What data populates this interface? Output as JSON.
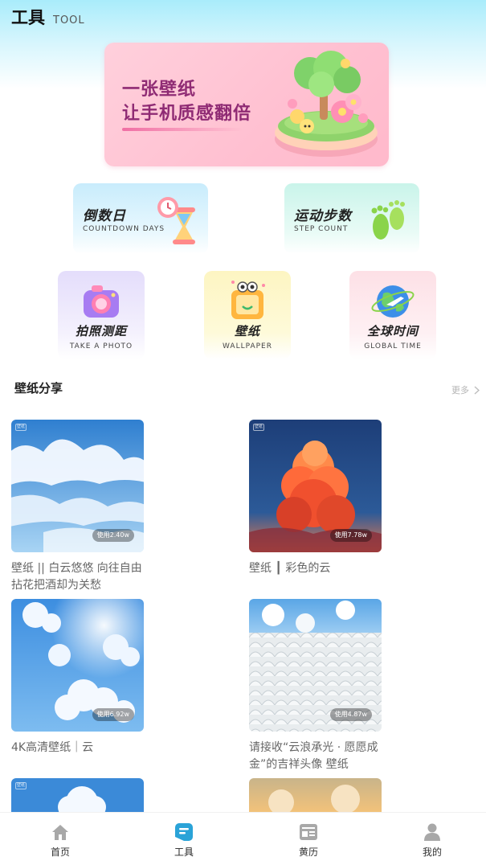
{
  "header": {
    "title": "工具",
    "subtitle": "TOOL"
  },
  "banner": {
    "line1": "一张壁纸",
    "line2": "让手机质感翻倍"
  },
  "tools_wide": [
    {
      "title": "倒数日",
      "subtitle": "COUNTDOWN DAYS",
      "icon": "hourglass-clock-icon"
    },
    {
      "title": "运动步数",
      "subtitle": "STEP COUNT",
      "icon": "footprints-icon"
    }
  ],
  "tools_square": [
    {
      "title": "拍照测距",
      "subtitle": "TAKE A PHOTO",
      "icon": "camera-icon"
    },
    {
      "title": "壁纸",
      "subtitle": "WALLPAPER",
      "icon": "wallpaper-robot-icon"
    },
    {
      "title": "全球时间",
      "subtitle": "GLOBAL TIME",
      "icon": "globe-plane-icon"
    }
  ],
  "section": {
    "title": "壁纸分享",
    "more": "更多"
  },
  "wallpapers": [
    {
      "badge": "使用2.40w",
      "caption": "壁纸 || 白云悠悠 向往自由 拈花把酒却为关愁"
    },
    {
      "badge": "使用7.78w",
      "caption": "壁纸 ┃ 彩色的云"
    },
    {
      "badge": "使用6.92w",
      "caption": "4K高清壁纸｜云"
    },
    {
      "badge": "使用4.87w",
      "caption": "请接收“云浪承光 · 愿愿成金”的吉祥头像 壁纸"
    }
  ],
  "nav": [
    {
      "label": "首页",
      "icon": "home-icon",
      "active": false
    },
    {
      "label": "工具",
      "icon": "tools-icon",
      "active": true
    },
    {
      "label": "黄历",
      "icon": "almanac-icon",
      "active": false
    },
    {
      "label": "我的",
      "icon": "profile-icon",
      "active": false
    }
  ],
  "colors": {
    "accent": "#2aa3d8",
    "banner_text": "#8f2b74",
    "nav_inactive": "#a8a8a8"
  }
}
